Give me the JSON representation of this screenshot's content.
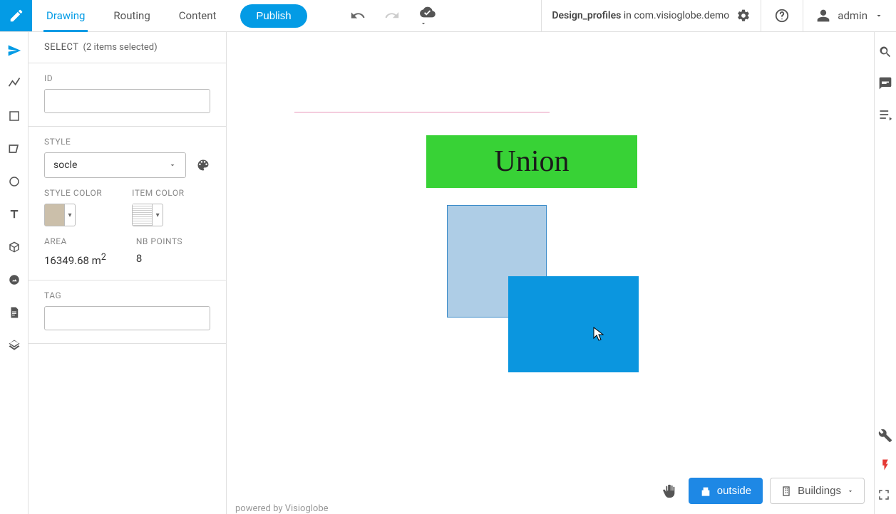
{
  "header": {
    "tabs": [
      "Drawing",
      "Routing",
      "Content"
    ],
    "publish": "Publish",
    "doc_title": "Design_profiles",
    "doc_context_prefix": " in ",
    "doc_context": "com.visioglobe.demo",
    "user": "admin"
  },
  "panel": {
    "select_label": "SELECT",
    "select_count": "(2 items selected)",
    "id_label": "ID",
    "id_value": "",
    "style_label": "STYLE",
    "style_value": "socle",
    "style_color_label": "STYLE COLOR",
    "style_color_hex": "#cbbfaa",
    "item_color_label": "ITEM COLOR",
    "item_color_hex": "#d9d9d9",
    "area_label": "AREA",
    "area_value": "16349.68 m",
    "area_exp": "2",
    "nbpoints_label": "NB POINTS",
    "nbpoints_value": "8",
    "tag_label": "TAG",
    "tag_value": ""
  },
  "canvas": {
    "union_label": "Union",
    "footer": "powered by Visioglobe"
  },
  "bottom": {
    "outside": "outside",
    "buildings": "Buildings"
  }
}
